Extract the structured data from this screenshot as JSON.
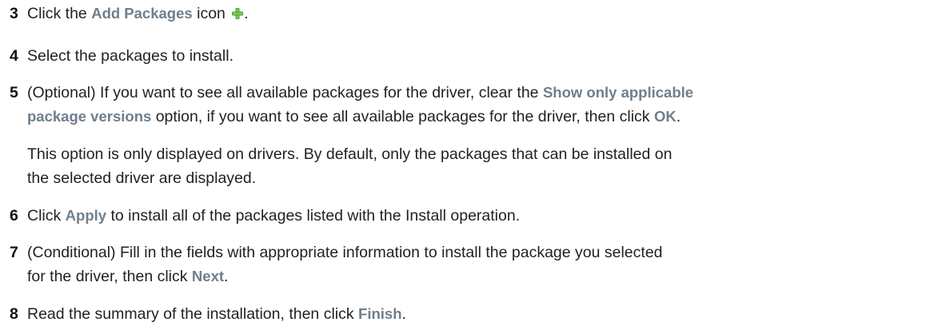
{
  "steps": [
    {
      "number": "3",
      "before": "Click the ",
      "ui": "Add Packages",
      "after": " icon ",
      "icon": "plus-icon",
      "end": "."
    },
    {
      "number": "4",
      "text": "Select the packages to install."
    },
    {
      "number": "5",
      "before": "(Optional) If you want to see all available packages for the driver, clear the ",
      "ui": "Show only applicable",
      "ui2": "package versions",
      "middle": " option, if you want to see all available packages for the driver, then click ",
      "ui3": "OK",
      "end": ".",
      "note_line1": "This option is only displayed on drivers. By default, only the packages that can be installed on",
      "note_line2": "the selected driver are displayed."
    },
    {
      "number": "6",
      "before": "Click ",
      "ui": "Apply",
      "after": " to install all of the packages listed with the Install operation."
    },
    {
      "number": "7",
      "line1": "(Conditional) Fill in the fields with appropriate information to install the package you selected",
      "before": "for the driver, then click ",
      "ui": "Next",
      "end": "."
    },
    {
      "number": "8",
      "before": "Read the summary of the installation, then click ",
      "ui": "Finish",
      "end": "."
    }
  ],
  "colors": {
    "ui_text": "#6f7f8c",
    "body_text": "#222222",
    "icon_green": "#5aa83a"
  }
}
